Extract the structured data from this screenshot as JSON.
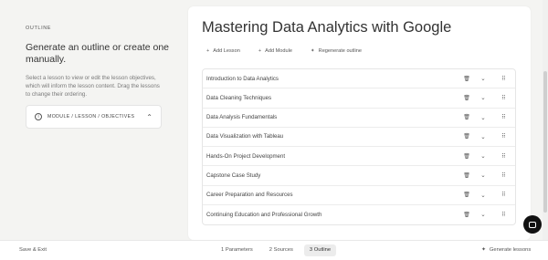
{
  "sidebar": {
    "eyebrow": "OUTLINE",
    "heading": "Generate an outline or create one manually.",
    "helper": "Select a lesson to view or edit the lesson objectives, which will inform the lesson content. Drag the lessons to change their ordering.",
    "module_box": {
      "label": "MODULE / LESSON / OBJECTIVES",
      "info_icon": "i",
      "chevron": "⌃"
    }
  },
  "main": {
    "title": "Mastering Data Analytics with Google",
    "actions": [
      {
        "icon": "+",
        "label": "Add Lesson"
      },
      {
        "icon": "+",
        "label": "Add Module"
      },
      {
        "icon": "✦",
        "label": "Regenerate outline"
      }
    ],
    "lessons": [
      {
        "title": "Introduction to Data Analytics"
      },
      {
        "title": "Data Cleaning Techniques"
      },
      {
        "title": "Data Analysis Fundamentals"
      },
      {
        "title": "Data Visualization with Tableau"
      },
      {
        "title": "Hands-On Project Development"
      },
      {
        "title": "Capstone Case Study"
      },
      {
        "title": "Career Preparation and Resources"
      },
      {
        "title": "Continuing Education and Professional Growth"
      }
    ],
    "row_icons": {
      "trash": "🗑",
      "chevron": "⌄",
      "grip": "⠿"
    }
  },
  "footer": {
    "save_exit": "Save & Exit",
    "steps": [
      {
        "label": "1  Parameters",
        "active": false
      },
      {
        "label": "2  Sources",
        "active": false
      },
      {
        "label": "3  Outline",
        "active": true
      }
    ],
    "generate_icon": "✦",
    "generate_label": "Generate lessons"
  }
}
